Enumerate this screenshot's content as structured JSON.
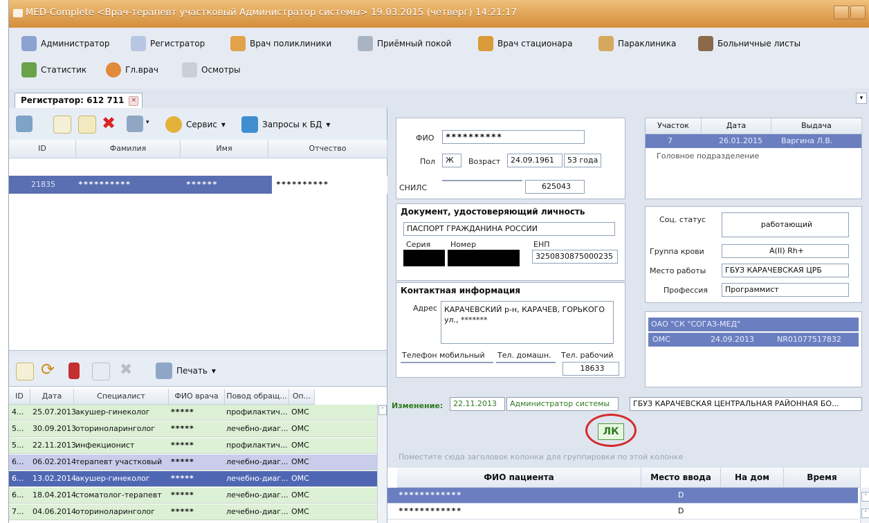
{
  "title": "MED-Complete   <Врач-терапевт участковый Администратор системы>   19.03.2015 (четверг) 14:21:17",
  "menu": [
    {
      "label": "Администратор",
      "color": "#8aa4cf"
    },
    {
      "label": "Регистратор",
      "color": "#b7c6e3"
    },
    {
      "label": "Врач поликлиники",
      "color": "#e1a24a"
    },
    {
      "label": "Приёмный покой",
      "color": "#a8b3c3"
    },
    {
      "label": "Врач стационара",
      "color": "#d99a3a"
    },
    {
      "label": "Параклиника",
      "color": "#d5a860"
    },
    {
      "label": "Больничные листы",
      "color": "#8a6a4a"
    },
    {
      "label": "Статистик",
      "color": "#6aa24a"
    },
    {
      "label": "Гл.врач",
      "color": "#e08a3a"
    },
    {
      "label": "Осмотры",
      "color": "#c9cfd8"
    }
  ],
  "tab": {
    "label": "Регистратор: 612 711"
  },
  "top_toolbar": {
    "service": "Сервис",
    "requests": "Запросы к БД"
  },
  "patients": {
    "columns": [
      "ID",
      "Фамилия",
      "Имя",
      "Отчество"
    ],
    "rows": [
      {
        "id": "21835",
        "surname": "**********",
        "name": "******",
        "patronymic": "**********"
      }
    ]
  },
  "bottom_toolbar": {
    "print": "Печать"
  },
  "visits": {
    "columns": [
      "ID",
      "Дата",
      "Специалист",
      "ФИО врача",
      "Повод обращ...",
      "Оп..."
    ],
    "rows": [
      {
        "id": "4...",
        "date": "25.07.2013",
        "spec": "акушер-гинеколог",
        "doctor": "*****",
        "reason": "профилактич...",
        "op": "ОМС",
        "style": "green"
      },
      {
        "id": "5...",
        "date": "30.09.2013",
        "spec": "оториноларинголог",
        "doctor": "*****",
        "reason": "лечебно-диаг...",
        "op": "ОМС",
        "style": "green"
      },
      {
        "id": "5...",
        "date": "22.11.2013",
        "spec": "инфекционист",
        "doctor": "*****",
        "reason": "профилактич...",
        "op": "ОМС",
        "style": "green"
      },
      {
        "id": "6...",
        "date": "06.02.2014",
        "spec": "терапевт участковый",
        "doctor": "*****",
        "reason": "лечебно-диаг...",
        "op": "ОМС",
        "style": "purple"
      },
      {
        "id": "6...",
        "date": "13.02.2014",
        "spec": "акушер-гинеколог",
        "doctor": "*****",
        "reason": "лечебно-диаг...",
        "op": "ОМС",
        "style": "blue"
      },
      {
        "id": "6...",
        "date": "18.04.2014",
        "spec": "стоматолог-терапевт",
        "doctor": "*****",
        "reason": "лечебно-диаг...",
        "op": "ОМС",
        "style": "green"
      },
      {
        "id": "7...",
        "date": "04.06.2014",
        "spec": "оториноларинголог",
        "doctor": "*****",
        "reason": "лечебно-диаг...",
        "op": "ОМС",
        "style": "green"
      }
    ]
  },
  "card": {
    "fio_label": "ФИО",
    "fio": "**********",
    "sex_label": "Пол",
    "sex": "Ж",
    "age_label": "Возраст",
    "birth": "24.09.1961",
    "age": "53 года",
    "snils_label": "СНИЛС",
    "snils_code": "625043",
    "doc_header": "Документ, удостоверяющий личность",
    "doc_type": "ПАСПОРТ ГРАЖДАНИНА РОССИИ",
    "series_label": "Серия",
    "number_label": "Номер",
    "enp_label": "ЕНП",
    "enp": "3250830875000235",
    "contact_header": "Контактная информация",
    "address_label": "Адрес",
    "address": "КАРАЧЕВСКИЙ р-н, КАРАЧЕВ, ГОРЬКОГО ул., *******",
    "mobile_label": "Телефон мобильный",
    "home_label": "Тел. домашн.",
    "work_label": "Тел. рабочий",
    "work_phone": "18633",
    "changed_label": "Изменение:",
    "changed_date": "22.11.2013",
    "changed_by": "Администратор системы",
    "org": "ГБУЗ КАРАЧЕВСКАЯ ЦЕНТРАЛЬНАЯ РАЙОННАЯ БО..."
  },
  "district": {
    "columns": [
      "Участок",
      "Дата",
      "Выдача"
    ],
    "row": {
      "num": "7",
      "date": "26.01.2015",
      "issue": "Варгина Л.В."
    },
    "subdivision": "Головное подразделение"
  },
  "social": {
    "status_label": "Соц. статус",
    "status": "работающий",
    "blood_label": "Группа крови",
    "blood": "A(II) Rh+",
    "work_label": "Место работы",
    "work": "ГБУЗ КАРАЧЕВСКАЯ ЦРБ",
    "prof_label": "Профессия",
    "prof": "Программист"
  },
  "insurance": {
    "company": "ОАО \"СК \"СОГАЗ-МЕД\"",
    "type": "ОМС",
    "date": "24.09.2013",
    "number": "NR01077517832"
  },
  "lk_button": "ЛК",
  "group_hint": "Поместите сюда заголовок колонки для группировки по этой колонке",
  "queue": {
    "columns": [
      "ФИО пациента",
      "Место ввода",
      "На дом",
      "Время"
    ],
    "rows": [
      {
        "fio": "************",
        "place": "D"
      },
      {
        "fio": "************",
        "place": "D"
      }
    ]
  }
}
